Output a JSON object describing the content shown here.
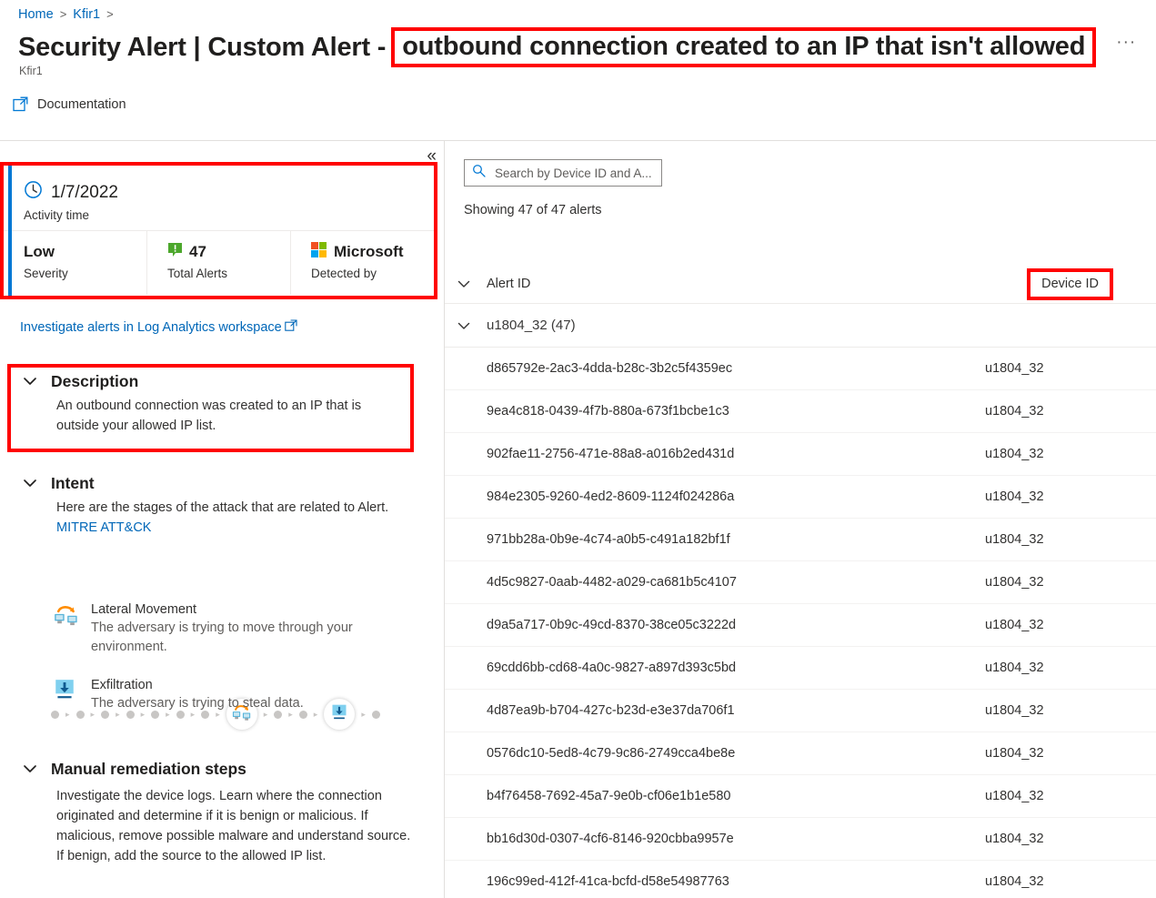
{
  "breadcrumb": {
    "items": [
      "Home",
      "Kfir1"
    ],
    "separator": ">"
  },
  "header": {
    "title_main": "Security Alert | Custom Alert -",
    "title_highlight": "outbound connection created to an IP that isn't allowed",
    "more_label": "···",
    "subtitle": "Kfir1"
  },
  "commandbar": {
    "documentation_label": "Documentation",
    "documentation_icon": "external-link-icon"
  },
  "left_panel": {
    "collapse_label": "«",
    "info_card": {
      "activity_time_value": "1/7/2022",
      "activity_time_label": "Activity time",
      "clock_icon": "clock-icon",
      "severity_value": "Low",
      "severity_label": "Severity",
      "total_alerts_value": "47",
      "total_alerts_label": "Total Alerts",
      "total_alerts_icon": "low-severity-badge-icon",
      "detected_by_value": "Microsoft",
      "detected_by_label": "Detected by",
      "detected_by_icon": "microsoft-logo-icon",
      "accent_color": "#0078d4",
      "highlight_color": "#ff0000"
    },
    "investigate_link": "Investigate alerts in Log Analytics workspace",
    "investigate_icon": "external-link-icon",
    "description": {
      "title": "Description",
      "body": "An outbound connection was created to an IP that is outside your allowed IP list."
    },
    "intent": {
      "title": "Intent",
      "body_prefix": "Here are the stages of the attack that are related to Alert.",
      "link_label": "MITRE ATT&CK",
      "killchain": {
        "dots_before": 7,
        "dots_between": 3,
        "dots_after": 1,
        "nodes": [
          "lateral-movement-icon",
          "exfiltration-icon"
        ]
      },
      "tactics": [
        {
          "icon": "lateral-movement-icon",
          "name": "Lateral Movement",
          "description": "The adversary is trying to move through your environment."
        },
        {
          "icon": "exfiltration-icon",
          "name": "Exfiltration",
          "description": "The adversary is trying to steal data."
        }
      ]
    },
    "remediation": {
      "title": "Manual remediation steps",
      "body": "Investigate the device logs. Learn where the connection originated and determine if it is benign or malicious. If malicious, remove possible malware and understand source. If benign, add the source to the allowed IP list."
    }
  },
  "right_panel": {
    "search": {
      "placeholder": "Search by Device ID and A...",
      "value": "",
      "icon": "search-icon"
    },
    "showing_text": "Showing 47 of 47 alerts",
    "columns": {
      "alert_id": "Alert ID",
      "device_id": "Device ID"
    },
    "group": {
      "label": "u1804_32 (47)"
    },
    "rows": [
      {
        "alert_id": "d865792e-2ac3-4dda-b28c-3b2c5f4359ec",
        "device_id": "u1804_32"
      },
      {
        "alert_id": "9ea4c818-0439-4f7b-880a-673f1bcbe1c3",
        "device_id": "u1804_32"
      },
      {
        "alert_id": "902fae11-2756-471e-88a8-a016b2ed431d",
        "device_id": "u1804_32"
      },
      {
        "alert_id": "984e2305-9260-4ed2-8609-1124f024286a",
        "device_id": "u1804_32"
      },
      {
        "alert_id": "971bb28a-0b9e-4c74-a0b5-c491a182bf1f",
        "device_id": "u1804_32"
      },
      {
        "alert_id": "4d5c9827-0aab-4482-a029-ca681b5c4107",
        "device_id": "u1804_32"
      },
      {
        "alert_id": "d9a5a717-0b9c-49cd-8370-38ce05c3222d",
        "device_id": "u1804_32"
      },
      {
        "alert_id": "69cdd6bb-cd68-4a0c-9827-a897d393c5bd",
        "device_id": "u1804_32"
      },
      {
        "alert_id": "4d87ea9b-b704-427c-b23d-e3e37da706f1",
        "device_id": "u1804_32"
      },
      {
        "alert_id": "0576dc10-5ed8-4c79-9c86-2749cca4be8e",
        "device_id": "u1804_32"
      },
      {
        "alert_id": "b4f76458-7692-45a7-9e0b-cf06e1b1e580",
        "device_id": "u1804_32"
      },
      {
        "alert_id": "bb16d30d-0307-4cf6-8146-920cbba9957e",
        "device_id": "u1804_32"
      },
      {
        "alert_id": "196c99ed-412f-41ca-bcfd-d58e54987763",
        "device_id": "u1804_32"
      }
    ]
  }
}
